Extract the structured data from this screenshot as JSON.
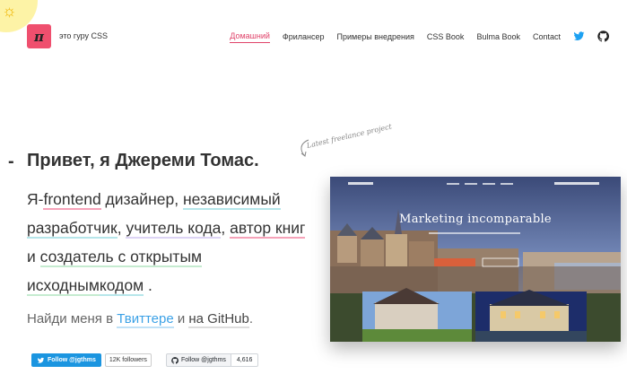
{
  "brand": {
    "logo_char": "π",
    "name": "это гуру CSS"
  },
  "nav": {
    "items": [
      {
        "label": "Домашний",
        "active": true
      },
      {
        "label": "Фрилансер",
        "active": false
      },
      {
        "label": "Примеры внедрения",
        "active": false
      },
      {
        "label": "CSS Book",
        "active": false
      },
      {
        "label": "Bulma Book",
        "active": false
      },
      {
        "label": "Contact",
        "active": false
      }
    ],
    "icons": [
      "twitter-icon",
      "github-icon"
    ]
  },
  "hero": {
    "dash": "-",
    "heading": "Привет, я Джереми Томас.",
    "intro": {
      "p1": "Я-",
      "frontend": "frontend",
      "p2": " дизайнер",
      "p3": ", ",
      "indep": "независимый разработчик",
      "p4": ", ",
      "teacher": "учитель кода",
      "p5": ", ",
      "author": "автор книг",
      "p6": " и ",
      "creator": "создатель с открытым исходным",
      "code": "кодом",
      "p7": " ."
    },
    "find": {
      "prefix": "Найди меня в ",
      "twitter": "Твиттере",
      "mid": " и ",
      "github": "на GitHub",
      "suffix": "."
    }
  },
  "buttons": {
    "twitter": {
      "label": "Follow @jgthms",
      "count": "12K followers"
    },
    "github": {
      "label": "Follow @jgthms",
      "count": "4,616"
    }
  },
  "project": {
    "caption": "Latest freelance project",
    "headline": "Marketing incomparable",
    "site_logo": "BERTHE MICHEL",
    "site_top_right": "+33 2 31 85 31 70"
  },
  "colors": {
    "accent": "#e0436a",
    "logo_bg": "#ef4f6e",
    "twitter": "#1b95e0"
  }
}
